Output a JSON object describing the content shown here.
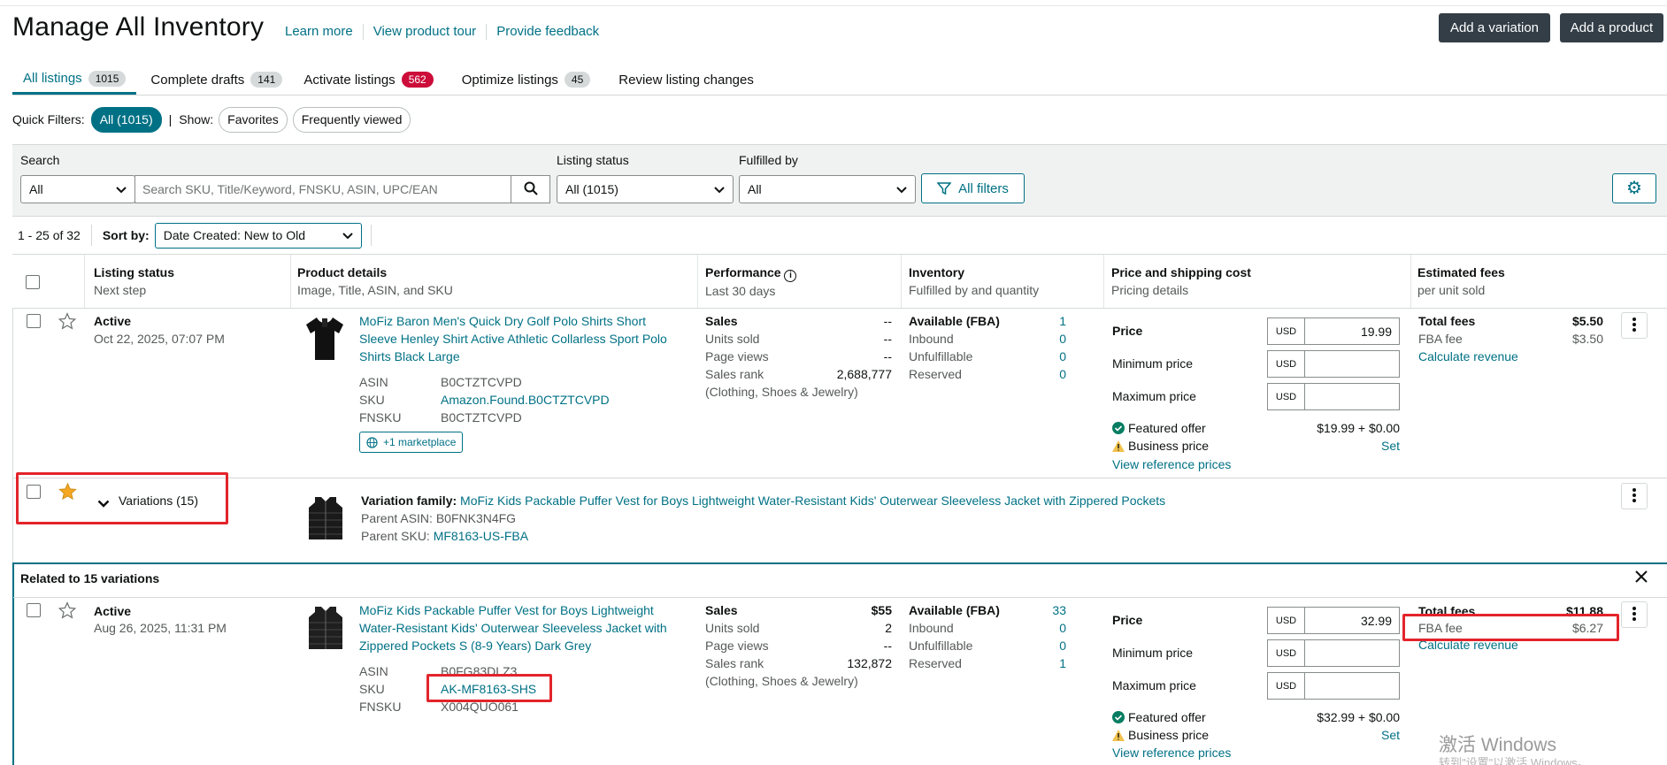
{
  "page": {
    "title": "Manage All Inventory",
    "links": [
      "Learn more",
      "View product tour",
      "Provide feedback"
    ],
    "add_variation": "Add a variation",
    "add_product": "Add a product"
  },
  "tabs": [
    {
      "label": "All listings",
      "count": "1015"
    },
    {
      "label": "Complete drafts",
      "count": "141"
    },
    {
      "label": "Activate listings",
      "count": "562"
    },
    {
      "label": "Optimize listings",
      "count": "45"
    },
    {
      "label": "Review listing changes"
    }
  ],
  "quick_filters": {
    "label": "Quick Filters:",
    "all": "All (1015)",
    "sep": "|",
    "show": "Show:",
    "favorites": "Favorites",
    "frequently_viewed": "Frequently viewed"
  },
  "filters": {
    "search_label": "Search",
    "search_scope": "All",
    "search_placeholder": "Search SKU, Title/Keyword, FNSKU, ASIN, UPC/EAN",
    "status_label": "Listing status",
    "status_value": "All (1015)",
    "fulfilled_label": "Fulfilled by",
    "fulfilled_value": "All",
    "all_filters": "All filters"
  },
  "sort": {
    "range": "1 - 25 of 32",
    "label": "Sort by:",
    "value": "Date Created: New to Old"
  },
  "columns": [
    {
      "title": "Listing status",
      "sub": "Next step"
    },
    {
      "title": "Product details",
      "sub": "Image, Title, ASIN, and SKU"
    },
    {
      "title": "Performance",
      "sub": "Last 30 days"
    },
    {
      "title": "Inventory",
      "sub": "Fulfilled by and quantity"
    },
    {
      "title": "Price and shipping cost",
      "sub": "Pricing details"
    },
    {
      "title": "Estimated fees",
      "sub": "per unit sold"
    }
  ],
  "row1": {
    "status": "Active",
    "date": "Oct 22, 2025, 07:07 PM",
    "title_l1": "MoFiz Baron Men's Quick Dry Golf Polo Shirts Short",
    "title_l2": "Sleeve Henley Shirt Active Athletic Collarless Sport Polo",
    "title_l3": "Shirts Black Large",
    "asin_label": "ASIN",
    "asin": "B0CTZTCVPD",
    "sku_label": "SKU",
    "sku": "Amazon.Found.B0CTZTCVPD",
    "fnsku_label": "FNSKU",
    "fnsku": "B0CTZTCVPD",
    "marketplace": "+1 marketplace",
    "perf": {
      "sales_label": "Sales",
      "sales": "--",
      "units_label": "Units sold",
      "units": "--",
      "views_label": "Page views",
      "views": "--",
      "rank_label": "Sales rank",
      "rank": "2,688,777",
      "category": "(Clothing, Shoes & Jewelry)"
    },
    "inv": {
      "avail_label": "Available (FBA)",
      "avail": "1",
      "inbound_label": "Inbound",
      "inbound": "0",
      "unful_label": "Unfulfillable",
      "unful": "0",
      "reserved_label": "Reserved",
      "reserved": "0"
    },
    "price": {
      "price_label": "Price",
      "currency": "USD",
      "price": "19.99",
      "min_label": "Minimum price",
      "max_label": "Maximum price",
      "featured_label": "Featured offer",
      "featured": "$19.99 + $0.00",
      "business_label": "Business price",
      "business": "Set",
      "reference": "View reference prices"
    },
    "fees": {
      "total_label": "Total fees",
      "total": "$5.50",
      "fba_label": "FBA fee",
      "fba": "$3.50",
      "calc": "Calculate revenue"
    }
  },
  "variation_row": {
    "label": "Variations (15)",
    "family_label": "Variation family:",
    "family": "MoFiz Kids Packable Puffer Vest for Boys Lightweight Water-Resistant Kids' Outerwear Sleeveless Jacket with Zippered Pockets",
    "parent_asin": "Parent ASIN: B0FNK3N4FG",
    "parent_sku_label": "Parent SKU:",
    "parent_sku": "MF8163-US-FBA"
  },
  "related": {
    "title": "Related to 15 variations"
  },
  "row2": {
    "status": "Active",
    "date": "Aug 26, 2025, 11:31 PM",
    "title_l1": "MoFiz Kids Packable Puffer Vest for Boys Lightweight",
    "title_l2": "Water-Resistant Kids' Outerwear Sleeveless Jacket with",
    "title_l3": "Zippered Pockets S (8-9 Years) Dark Grey",
    "asin_label": "ASIN",
    "asin": "B0FG83DLZ3",
    "sku_label": "SKU",
    "sku": "AK-MF8163-SHS",
    "fnsku_label": "FNSKU",
    "fnsku": "X004QUO061",
    "perf": {
      "sales_label": "Sales",
      "sales": "$55",
      "units_label": "Units sold",
      "units": "2",
      "views_label": "Page views",
      "views": "--",
      "rank_label": "Sales rank",
      "rank": "132,872",
      "category": "(Clothing, Shoes & Jewelry)"
    },
    "inv": {
      "avail_label": "Available (FBA)",
      "avail": "33",
      "inbound_label": "Inbound",
      "inbound": "0",
      "unful_label": "Unfulfillable",
      "unful": "0",
      "reserved_label": "Reserved",
      "reserved": "1"
    },
    "price": {
      "price_label": "Price",
      "currency": "USD",
      "price": "32.99",
      "min_label": "Minimum price",
      "max_label": "Maximum price",
      "featured_label": "Featured offer",
      "featured": "$32.99 + $0.00",
      "business_label": "Business price",
      "business": "Set",
      "reference": "View reference prices"
    },
    "fees": {
      "total_label": "Total fees",
      "total": "$11.88",
      "fba_label": "FBA fee",
      "fba": "$6.27",
      "calc": "Calculate revenue"
    }
  },
  "watermark": {
    "line1": "激活 Windows",
    "line2": "转到\"设置\"以激活 Windows。"
  },
  "colors": {
    "teal": "#007185",
    "dark_button": "#333e47",
    "badge_red": "#cc0c39",
    "highlight_red": "#e3242b",
    "star": "#f5a623"
  }
}
